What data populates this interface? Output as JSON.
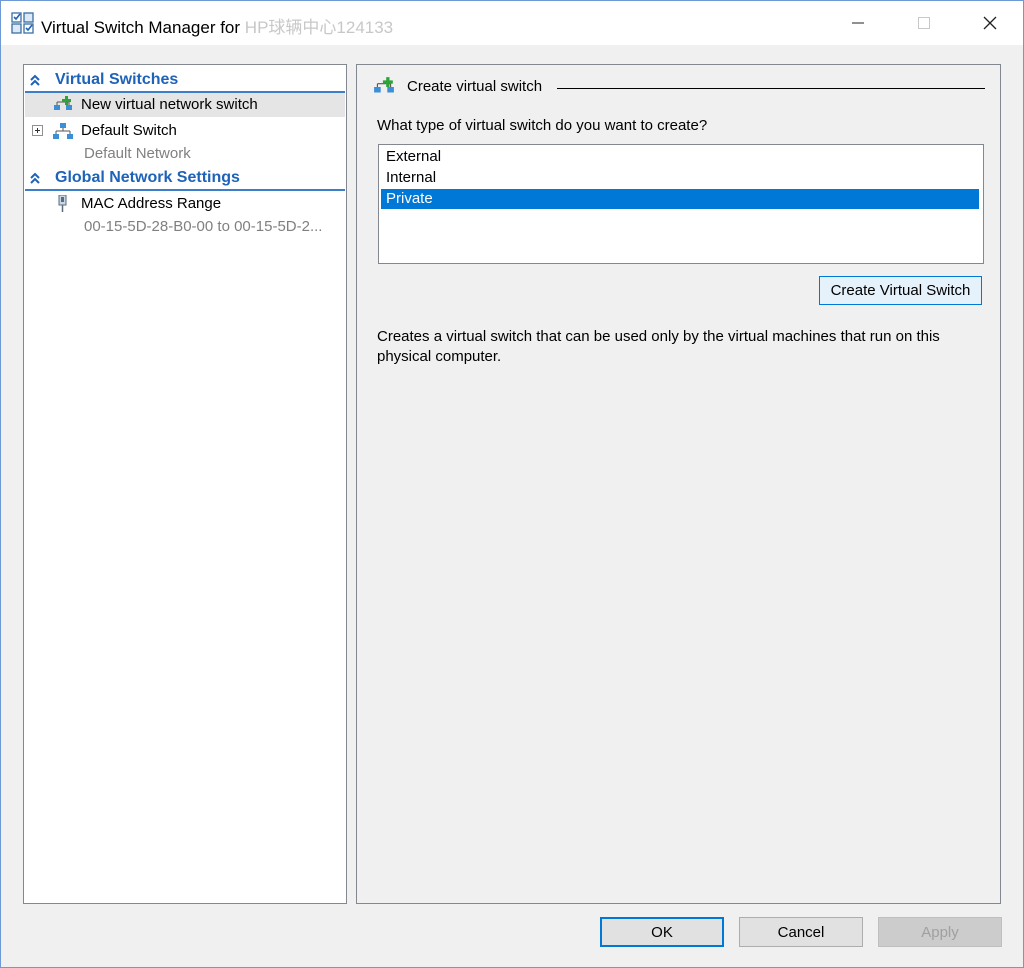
{
  "window": {
    "title": "Virtual Switch Manager for",
    "host_name": "HP球辆中心124133",
    "controls": {
      "minimize": "—",
      "maximize": "☐",
      "close": "✕"
    }
  },
  "sidebar": {
    "virtual_switches_header": "Virtual Switches",
    "new_switch_label": "New virtual network switch",
    "default_switch_label": "Default Switch",
    "default_switch_sub": "Default Network",
    "global_settings_header": "Global Network Settings",
    "mac_range_label": "MAC Address Range",
    "mac_range_sub": "00-15-5D-28-B0-00 to 00-15-5D-2..."
  },
  "main": {
    "group_title": "Create virtual switch",
    "question": "What type of virtual switch do you want to create?",
    "options": [
      "External",
      "Internal",
      "Private"
    ],
    "selected_option": "Private",
    "create_button": "Create Virtual Switch",
    "description": "Creates a virtual switch that can be used only by the virtual machines that run on this physical computer."
  },
  "footer": {
    "ok": "OK",
    "cancel": "Cancel",
    "apply": "Apply"
  },
  "colors": {
    "accent": "#0078d7",
    "header_text": "#1e63b8",
    "selection": "#0078d7"
  },
  "icons": {
    "title": "virtual-switch-manager-icon",
    "section": "double-chevron-up-icon",
    "new_switch": "new-switch-icon",
    "switch": "network-switch-icon",
    "mac": "network-adapter-icon"
  }
}
